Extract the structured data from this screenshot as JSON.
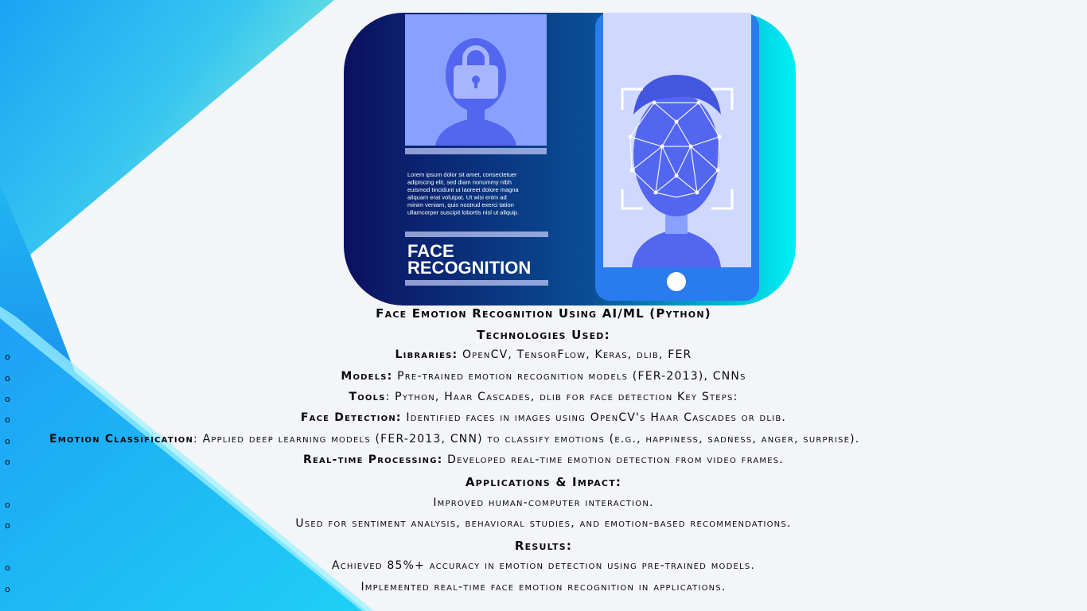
{
  "hero": {
    "lorem": [
      "Lorem ipsum dolor sit amet, consectetuer",
      "adipiscing elit, sed diam nonummy nibh",
      "euismod tincidunt ut laoreet dolore magna",
      "aliquam erat volutpat. Ut wisi enim ad",
      "minim veniam, quis nostrud exerci tation",
      "ullamcorper suscipit lobortis nisl ut aliquip."
    ],
    "title_line1": "FACE",
    "title_line2": "RECOGNITION"
  },
  "slide": {
    "title": "Face Emotion Recognition Using AI/ML (Python)",
    "tech_heading": "Technologies Used:",
    "tech_items": [
      {
        "label": "Libraries:",
        "text": " OpenCV, TensorFlow, Keras, dlib, FER"
      },
      {
        "label": "Models:",
        "text": " Pre-trained emotion recognition models (FER-2013), CNNs"
      },
      {
        "label": "Tools",
        "text": ": Python, Haar Cascades, dlib for face detection Key Steps:"
      },
      {
        "label": "Face Detection:",
        "text": " Identified faces in images using OpenCV's Haar Cascades or dlib."
      },
      {
        "label": "Emotion Classification",
        "text": ": Applied deep learning models (FER-2013, CNN) to classify emotions (e.g., happiness, sadness, anger, surprise)."
      },
      {
        "label": "Real-time Processing:",
        "text": " Developed real-time emotion detection from video frames."
      }
    ],
    "apps_heading": "Applications & Impact:",
    "apps_items": [
      "Improved human-computer interaction.",
      "Used for sentiment analysis, behavioral studies, and emotion-based recommendations."
    ],
    "results_heading": "Results:",
    "results_items": [
      "Achieved 85%+ accuracy in emotion detection using pre-trained models.",
      "Implemented real-time face emotion recognition in applications."
    ],
    "bullet_char": "o"
  },
  "colors": {
    "bg": "#f4f5f7",
    "accent_blue": "#1a9bf0",
    "accent_cyan": "#2ee0f0",
    "hero_navy": "#0f1a6e",
    "text": "#0a0a14"
  }
}
